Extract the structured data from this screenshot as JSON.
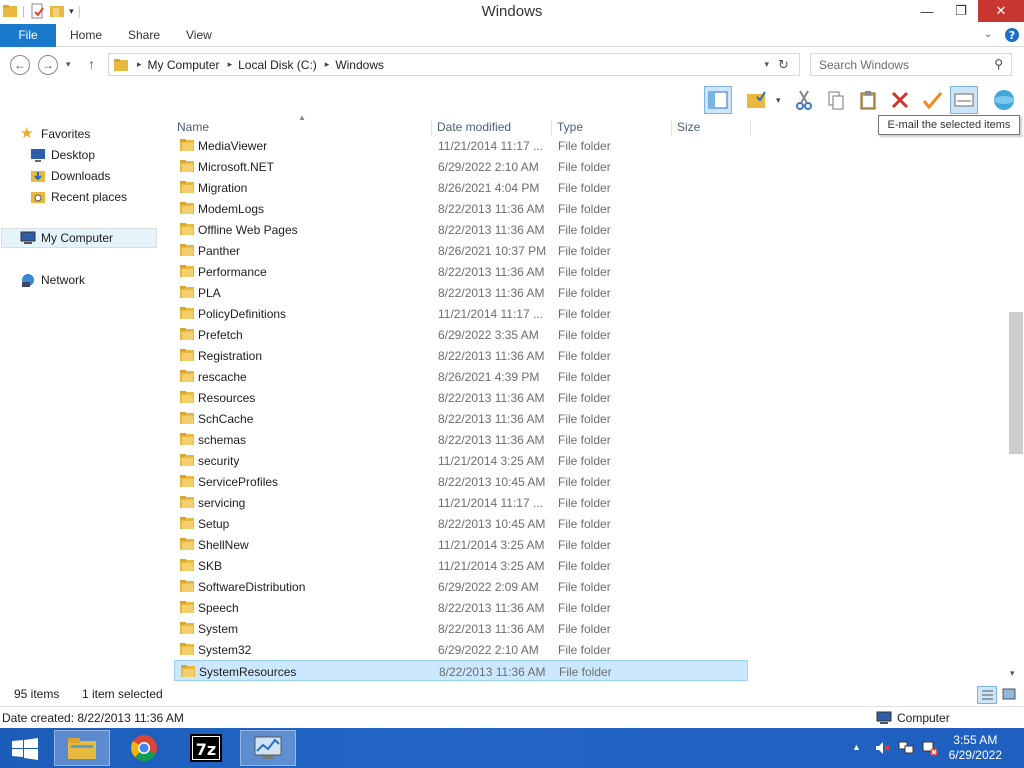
{
  "window": {
    "title": "Windows"
  },
  "ribbon": {
    "file": "File",
    "home": "Home",
    "share": "Share",
    "view": "View"
  },
  "address": {
    "crumbs": [
      "My Computer",
      "Local Disk (C:)",
      "Windows"
    ],
    "search_placeholder": "Search Windows"
  },
  "tooltip": "E-mail the selected items",
  "nav": {
    "favorites": "Favorites",
    "desktop": "Desktop",
    "downloads": "Downloads",
    "recent": "Recent places",
    "computer": "My Computer",
    "network": "Network"
  },
  "columns": {
    "name": "Name",
    "date": "Date modified",
    "type": "Type",
    "size": "Size"
  },
  "files": [
    {
      "name": "MediaViewer",
      "date": "11/21/2014 11:17 ...",
      "type": "File folder"
    },
    {
      "name": "Microsoft.NET",
      "date": "6/29/2022 2:10 AM",
      "type": "File folder"
    },
    {
      "name": "Migration",
      "date": "8/26/2021 4:04 PM",
      "type": "File folder"
    },
    {
      "name": "ModemLogs",
      "date": "8/22/2013 11:36 AM",
      "type": "File folder"
    },
    {
      "name": "Offline Web Pages",
      "date": "8/22/2013 11:36 AM",
      "type": "File folder"
    },
    {
      "name": "Panther",
      "date": "8/26/2021 10:37 PM",
      "type": "File folder"
    },
    {
      "name": "Performance",
      "date": "8/22/2013 11:36 AM",
      "type": "File folder"
    },
    {
      "name": "PLA",
      "date": "8/22/2013 11:36 AM",
      "type": "File folder"
    },
    {
      "name": "PolicyDefinitions",
      "date": "11/21/2014 11:17 ...",
      "type": "File folder"
    },
    {
      "name": "Prefetch",
      "date": "6/29/2022 3:35 AM",
      "type": "File folder"
    },
    {
      "name": "Registration",
      "date": "8/22/2013 11:36 AM",
      "type": "File folder"
    },
    {
      "name": "rescache",
      "date": "8/26/2021 4:39 PM",
      "type": "File folder"
    },
    {
      "name": "Resources",
      "date": "8/22/2013 11:36 AM",
      "type": "File folder"
    },
    {
      "name": "SchCache",
      "date": "8/22/2013 11:36 AM",
      "type": "File folder"
    },
    {
      "name": "schemas",
      "date": "8/22/2013 11:36 AM",
      "type": "File folder"
    },
    {
      "name": "security",
      "date": "11/21/2014 3:25 AM",
      "type": "File folder"
    },
    {
      "name": "ServiceProfiles",
      "date": "8/22/2013 10:45 AM",
      "type": "File folder"
    },
    {
      "name": "servicing",
      "date": "11/21/2014 11:17 ...",
      "type": "File folder"
    },
    {
      "name": "Setup",
      "date": "8/22/2013 10:45 AM",
      "type": "File folder"
    },
    {
      "name": "ShellNew",
      "date": "11/21/2014 3:25 AM",
      "type": "File folder"
    },
    {
      "name": "SKB",
      "date": "11/21/2014 3:25 AM",
      "type": "File folder"
    },
    {
      "name": "SoftwareDistribution",
      "date": "6/29/2022 2:09 AM",
      "type": "File folder"
    },
    {
      "name": "Speech",
      "date": "8/22/2013 11:36 AM",
      "type": "File folder"
    },
    {
      "name": "System",
      "date": "8/22/2013 11:36 AM",
      "type": "File folder"
    },
    {
      "name": "System32",
      "date": "6/29/2022 2:10 AM",
      "type": "File folder"
    },
    {
      "name": "SystemResources",
      "date": "8/22/2013 11:36 AM",
      "type": "File folder",
      "selected": true
    }
  ],
  "status": {
    "count": "95 items",
    "selected": "1 item selected"
  },
  "details": {
    "created": "Date created: 8/22/2013 11:36 AM",
    "location": "Computer"
  },
  "taskbar": {
    "time": "3:55 AM",
    "date": "6/29/2022"
  }
}
